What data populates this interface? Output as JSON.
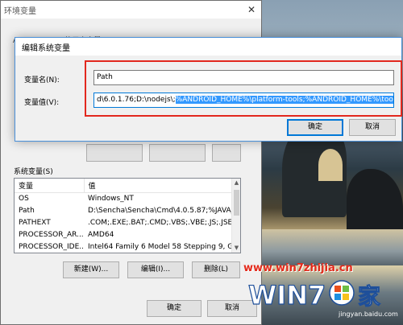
{
  "background_window": {
    "title": "环境变量",
    "close_glyph": "✕",
    "user_group_label": "Administrator 的用户变量(U)",
    "system_group_label": "系统变量(S)",
    "system_table": {
      "headers": [
        "变量",
        "值"
      ],
      "rows": [
        [
          "OS",
          "Windows_NT"
        ],
        [
          "Path",
          "D:\\Sencha\\Sencha\\Cmd\\4.0.5.87;%JAVA_..."
        ],
        [
          "PATHEXT",
          ".COM;.EXE;.BAT;.CMD;.VBS;.VBE;.JS;.JSE;..."
        ],
        [
          "PROCESSOR_AR...",
          "AMD64"
        ],
        [
          "PROCESSOR_IDE...",
          "Intel64 Family 6 Model 58 Stepping 9, G..."
        ]
      ]
    },
    "buttons": {
      "new": "新建(W)...",
      "edit": "编辑(I)...",
      "delete": "删除(L)",
      "ok": "确定",
      "cancel": "取消"
    }
  },
  "edit_dialog": {
    "title": "编辑系统变量",
    "name_label": "变量名(N):",
    "name_value": "Path",
    "value_label": "变量值(V):",
    "value_plain": "d\\6.0.1.76;D:\\nodejs\\;",
    "value_selected": "%ANDROID_HOME%\\platform-tools;%ANDROID_HOME%\\tools;",
    "ok": "确定",
    "cancel": "取消"
  },
  "watermark": {
    "url": "www.win7zhijia.cn",
    "logo_text": "WIN7 之家",
    "small_text": "jingyan.baidu.com"
  },
  "colors": {
    "highlight_box": "#e2281e",
    "selection": "#3399ff",
    "primary_button_border": "#0078d7"
  }
}
